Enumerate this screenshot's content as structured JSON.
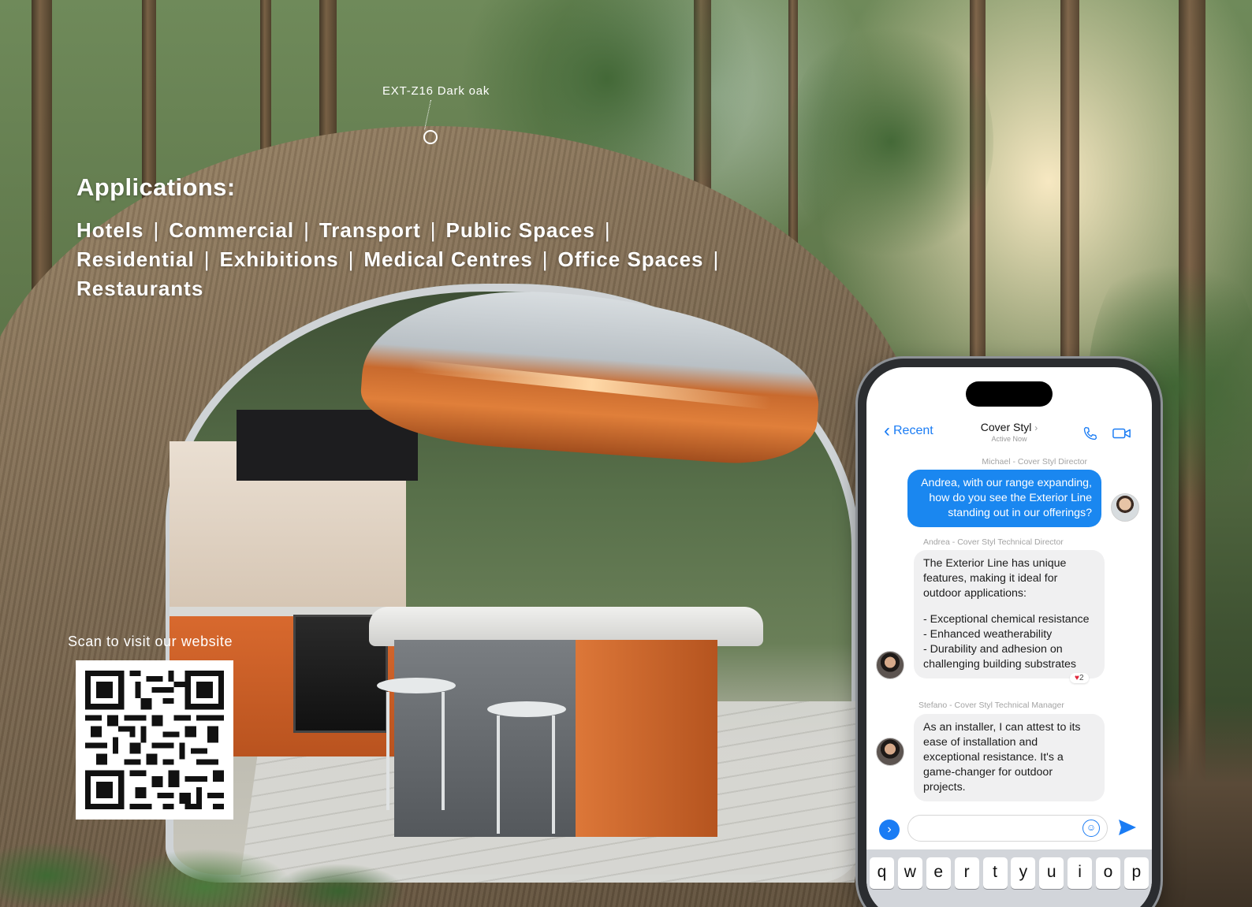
{
  "callout": {
    "label": "EXT-Z16 Dark oak"
  },
  "applications": {
    "heading": "Applications:",
    "items": [
      "Hotels",
      "Commercial",
      "Transport",
      "Public Spaces",
      "Residential",
      "Exhibitions",
      "Medical Centres",
      "Office Spaces",
      "Restaurants"
    ],
    "separator": "|"
  },
  "qr_section": {
    "label": "Scan to visit our website"
  },
  "phone": {
    "header": {
      "back_label": "Recent",
      "contact_name": "Cover Styl",
      "contact_status": "Active Now"
    },
    "messages": [
      {
        "sender": "Michael - Cover Styl Director",
        "direction": "out",
        "text": "Andrea, with our range expanding, how do you see the Exterior Line standing out in our offerings?"
      },
      {
        "sender": "Andrea - Cover Styl Technical Director",
        "direction": "in",
        "paragraphs": [
          "The Exterior Line has unique features, making it ideal for outdoor applications:",
          "- Exceptional chemical resistance\n- Enhanced weatherability\n- Durability and adhesion on challenging building substrates"
        ],
        "reaction": {
          "icon": "heart-icon",
          "count": "2"
        }
      },
      {
        "sender": "Stefano - Cover Styl Technical Manager",
        "direction": "in",
        "text": "As an installer, I can attest to its ease of installation and exceptional resistance. It's a game-changer for outdoor projects."
      }
    ],
    "composer": {
      "value": "",
      "placeholder": ""
    },
    "keyboard_row": [
      "q",
      "w",
      "e",
      "r",
      "t",
      "y",
      "u",
      "i",
      "o",
      "p"
    ]
  },
  "colors": {
    "ios_blue": "#1a87f0",
    "incoming_bubble": "#f0f0f1",
    "overlay_text": "#ffffff"
  }
}
